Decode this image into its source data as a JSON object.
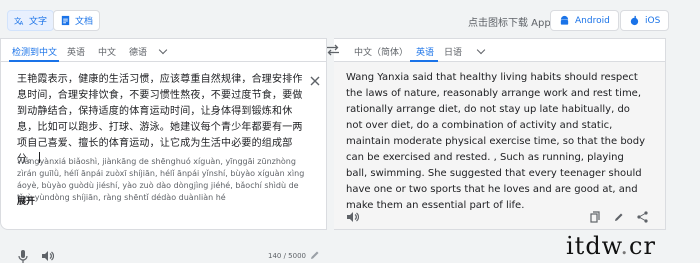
{
  "topbar": {
    "text_mode_label": "文字",
    "doc_mode_label": "文档",
    "app_download_text": "点击图标下载 App",
    "android_label": "Android",
    "ios_label": "iOS"
  },
  "source": {
    "langs": [
      "检测到中文",
      "英语",
      "中文",
      "德语"
    ],
    "text": "王艳霞表示，健康的生活习惯，应该尊重自然规律，合理安排作息时间，合理安排饮食，不要习惯性熬夜，不要过度节食，要做到动静结合，保持适度的体育运动时间，让身体得到锻炼和休息，比如可以跑步、打球、游泳。她建议每个青少年都要有一两项自己喜爱、擅长的体育运动，让它成为生活中必要的组成部分。",
    "romanization": "Wángyànxiá biǎoshì, jiànkāng de shēnghuó xíguàn, yīnggāi zūnzhòng zìrán guīlǜ, hélǐ ānpái zuòxī shíjiān, hélǐ ānpái yǐnshí, bùyào xíguàn xìng áoyè, bùyào guòdù jiéshí, yào zuò dào dòngjìng jiéhé, bǎochí shìdù de tǐyù yùndòng shíjiān, ràng shēntǐ dédào duànliàn hé",
    "expand_label": "展开",
    "char_count": "140 / 5000"
  },
  "target": {
    "langs": [
      "中文（简体）",
      "英语",
      "日语"
    ],
    "text": "Wang Yanxia said that healthy living habits should respect the laws of nature, reasonably arrange work and rest time, rationally arrange diet, do not stay up late habitually, do not over diet, do a combination of activity and static, maintain moderate physical exercise time, so that the body can be exercised and rested. , Such as running, playing ball, swimming. She suggested that every teenager should have one or two sports that he loves and are good at, and make them an essential part of life."
  },
  "watermark": {
    "text": "itdw",
    "dot": ".",
    "suffix": "cr"
  },
  "colors": {
    "accent": "#1a73e8",
    "border": "#dadce0",
    "background": "#f1f3f4"
  }
}
